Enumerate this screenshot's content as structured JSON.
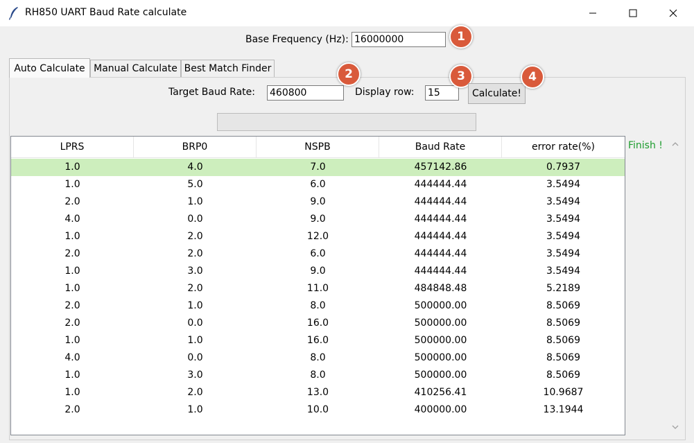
{
  "window": {
    "title": "RH850 UART Baud Rate calculate"
  },
  "base_frequency": {
    "label": "Base Frequency (Hz):",
    "value": "16000000"
  },
  "tabs": [
    {
      "label": "Auto Calculate",
      "active": true
    },
    {
      "label": "Manual Calculate",
      "active": false
    },
    {
      "label": "Best Match Finder",
      "active": false
    }
  ],
  "target_baud": {
    "label": "Target Baud Rate:",
    "value": "460800"
  },
  "display_row": {
    "label": "Display row:",
    "value": "15"
  },
  "calculate_label": "Calculate!",
  "markers": [
    "1",
    "2",
    "3",
    "4"
  ],
  "progress": {
    "fraction": 0
  },
  "status_text": "Finish !",
  "table": {
    "columns": [
      "LPRS",
      "BRP0",
      "NSPB",
      "Baud Rate",
      "error rate(%)"
    ],
    "selected_row": 0,
    "rows": [
      [
        "1.0",
        "4.0",
        "7.0",
        "457142.86",
        "0.7937"
      ],
      [
        "1.0",
        "5.0",
        "6.0",
        "444444.44",
        "3.5494"
      ],
      [
        "2.0",
        "1.0",
        "9.0",
        "444444.44",
        "3.5494"
      ],
      [
        "4.0",
        "0.0",
        "9.0",
        "444444.44",
        "3.5494"
      ],
      [
        "1.0",
        "2.0",
        "12.0",
        "444444.44",
        "3.5494"
      ],
      [
        "2.0",
        "2.0",
        "6.0",
        "444444.44",
        "3.5494"
      ],
      [
        "1.0",
        "3.0",
        "9.0",
        "444444.44",
        "3.5494"
      ],
      [
        "1.0",
        "2.0",
        "11.0",
        "484848.48",
        "5.2189"
      ],
      [
        "2.0",
        "1.0",
        "8.0",
        "500000.00",
        "8.5069"
      ],
      [
        "2.0",
        "0.0",
        "16.0",
        "500000.00",
        "8.5069"
      ],
      [
        "1.0",
        "1.0",
        "16.0",
        "500000.00",
        "8.5069"
      ],
      [
        "4.0",
        "0.0",
        "8.0",
        "500000.00",
        "8.5069"
      ],
      [
        "1.0",
        "3.0",
        "8.0",
        "500000.00",
        "8.5069"
      ],
      [
        "1.0",
        "2.0",
        "13.0",
        "410256.41",
        "10.9687"
      ],
      [
        "2.0",
        "1.0",
        "10.0",
        "400000.00",
        "13.1944"
      ]
    ]
  },
  "colors": {
    "marker": "#d95a3b",
    "selected_row": "#cdeebd",
    "status": "#1c9c2d"
  },
  "icons": [
    "feather-icon",
    "minimize-icon",
    "maximize-icon",
    "close-icon",
    "scroll-up-icon",
    "scroll-down-icon"
  ]
}
